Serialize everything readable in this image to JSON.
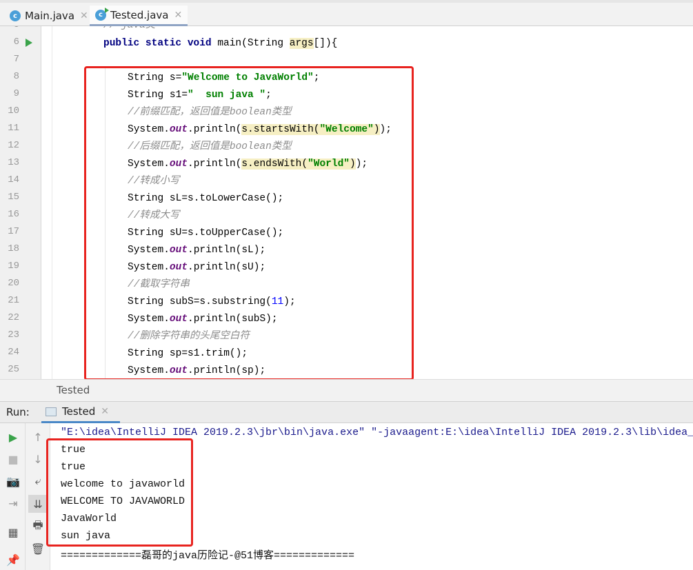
{
  "tabs": [
    {
      "label": "Main.java",
      "active": false
    },
    {
      "label": "Tested.java",
      "active": true
    }
  ],
  "editor": {
    "partial_line": {
      "num": "5",
      "text": "// java类"
    },
    "lines": [
      {
        "num": "6",
        "indent": 2,
        "segs": [
          [
            "kw",
            "public static void "
          ],
          [
            "",
            "main(String "
          ],
          [
            "hl",
            "args"
          ],
          [
            "",
            "[]){"
          ]
        ]
      },
      {
        "num": "7",
        "indent": 2,
        "segs": []
      },
      {
        "num": "8",
        "indent": 3,
        "segs": [
          [
            "",
            "String s="
          ],
          [
            "str",
            "\"Welcome to JavaWorld\""
          ],
          [
            "",
            ";"
          ]
        ]
      },
      {
        "num": "9",
        "indent": 3,
        "segs": [
          [
            "",
            "String s1="
          ],
          [
            "str",
            "\"  sun java \""
          ],
          [
            "",
            ";"
          ]
        ]
      },
      {
        "num": "10",
        "indent": 3,
        "segs": [
          [
            "cm",
            "//前缀匹配，返回值是boolean类型"
          ]
        ]
      },
      {
        "num": "11",
        "indent": 3,
        "segs": [
          [
            "",
            "System."
          ],
          [
            "out",
            "out"
          ],
          [
            "",
            ".println("
          ],
          [
            "hl",
            "s.startsWith("
          ],
          [
            "hl str",
            "\"Welcome\""
          ],
          [
            "hl",
            ")"
          ],
          [
            "",
            ");"
          ]
        ]
      },
      {
        "num": "12",
        "indent": 3,
        "segs": [
          [
            "cm",
            "//后缀匹配，返回值是boolean类型"
          ]
        ]
      },
      {
        "num": "13",
        "indent": 3,
        "segs": [
          [
            "",
            "System."
          ],
          [
            "out",
            "out"
          ],
          [
            "",
            ".println("
          ],
          [
            "hl",
            "s.endsWith("
          ],
          [
            "hl str",
            "\"World\""
          ],
          [
            "hl",
            ")"
          ],
          [
            "",
            ");"
          ]
        ]
      },
      {
        "num": "14",
        "indent": 3,
        "segs": [
          [
            "cm",
            "//转成小写"
          ]
        ]
      },
      {
        "num": "15",
        "indent": 3,
        "segs": [
          [
            "",
            "String sL=s.toLowerCase();"
          ]
        ]
      },
      {
        "num": "16",
        "indent": 3,
        "segs": [
          [
            "cm",
            "//转成大写"
          ]
        ]
      },
      {
        "num": "17",
        "indent": 3,
        "segs": [
          [
            "",
            "String sU=s.toUpperCase();"
          ]
        ]
      },
      {
        "num": "18",
        "indent": 3,
        "segs": [
          [
            "",
            "System."
          ],
          [
            "out",
            "out"
          ],
          [
            "",
            ".println(sL);"
          ]
        ]
      },
      {
        "num": "19",
        "indent": 3,
        "segs": [
          [
            "",
            "System."
          ],
          [
            "out",
            "out"
          ],
          [
            "",
            ".println(sU);"
          ]
        ]
      },
      {
        "num": "20",
        "indent": 3,
        "segs": [
          [
            "cm",
            "//截取字符串"
          ]
        ]
      },
      {
        "num": "21",
        "indent": 3,
        "segs": [
          [
            "",
            "String subS=s.substring("
          ],
          [
            "num",
            "11"
          ],
          [
            "",
            ");"
          ]
        ]
      },
      {
        "num": "22",
        "indent": 3,
        "segs": [
          [
            "",
            "System."
          ],
          [
            "out",
            "out"
          ],
          [
            "",
            ".println(subS);"
          ]
        ]
      },
      {
        "num": "23",
        "indent": 3,
        "segs": [
          [
            "cm",
            "//删除字符串的头尾空白符"
          ]
        ]
      },
      {
        "num": "24",
        "indent": 3,
        "segs": [
          [
            "",
            "String sp=s1.trim();"
          ]
        ]
      },
      {
        "num": "25",
        "indent": 3,
        "segs": [
          [
            "",
            "System."
          ],
          [
            "out",
            "out"
          ],
          [
            "",
            ".println(sp);"
          ]
        ]
      }
    ]
  },
  "breadcrumb": "Tested",
  "run": {
    "label": "Run:",
    "tab": "Tested"
  },
  "console": {
    "command": "\"E:\\idea\\IntelliJ IDEA 2019.2.3\\jbr\\bin\\java.exe\" \"-javaagent:E:\\idea\\IntelliJ IDEA 2019.2.3\\lib\\idea_",
    "output": [
      "true",
      "true",
      "welcome to javaworld",
      "WELCOME TO JAVAWORLD",
      "JavaWorld",
      "sun java"
    ],
    "footer": "=============磊哥的java历险记-@51博客============="
  },
  "colors": {
    "highlight_box": "#e8231f",
    "run_green": "#3aa34a",
    "accent": "#4a9fd8"
  }
}
